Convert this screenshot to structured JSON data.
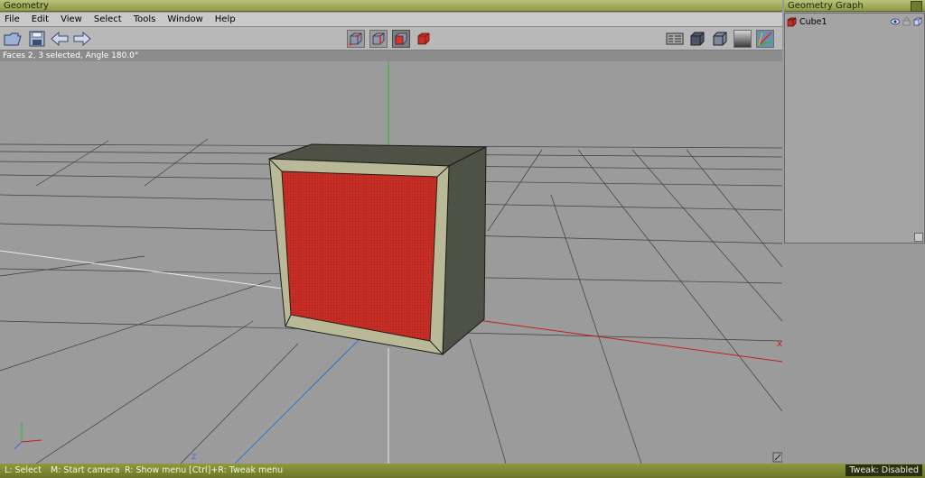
{
  "window": {
    "title": "Geometry"
  },
  "menu": {
    "items": [
      "File",
      "Edit",
      "View",
      "Select",
      "Tools",
      "Window",
      "Help"
    ]
  },
  "toolbar": {
    "left_icons": [
      "open-folder-icon",
      "save-icon",
      "undo-arrow-icon",
      "redo-arrow-icon"
    ],
    "mode_icons": [
      "vertex-mode-icon",
      "edge-mode-icon",
      "face-mode-icon",
      "object-mode-icon"
    ],
    "right_icons": [
      "display-settings-icon",
      "shaded-sphere-icon",
      "shaded-cube-icon",
      "texture-icon",
      "axes-icon"
    ],
    "accent_color": "#d8322a"
  },
  "viewport": {
    "status": "Faces 2, 3 selected, Angle 180.0°",
    "axis_x_label": "x",
    "axis_z_label": "z",
    "axis_colors": {
      "x": "#c81d1d",
      "y": "#2db52d",
      "z": "#3a6ed6"
    },
    "selected_face_color": "#c52e25"
  },
  "graph": {
    "title": "Geometry Graph",
    "items": [
      {
        "label": "Cube1"
      }
    ]
  },
  "statusbar": {
    "hints": [
      "L: Select",
      "M: Start camera",
      "R: Show menu",
      "[Ctrl]+R: Tweak menu"
    ],
    "tweak": "Tweak: Disabled"
  }
}
